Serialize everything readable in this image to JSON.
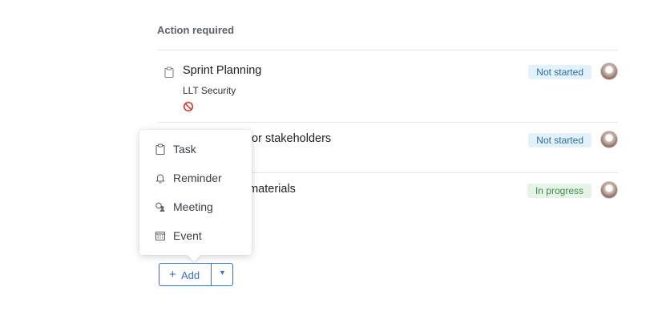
{
  "section": {
    "title": "Action required"
  },
  "items": [
    {
      "icon": "clipboard-icon",
      "title": "Sprint Planning",
      "subtitle": "LLT Security",
      "blocked_icon": "blocked-icon",
      "status": "Not started"
    },
    {
      "title_visible": "for stakeholders",
      "status": "Not started"
    },
    {
      "title_visible": "n materials",
      "status": "In progress"
    }
  ],
  "menu": {
    "items": [
      {
        "label": "Task",
        "icon": "clipboard-icon"
      },
      {
        "label": "Reminder",
        "icon": "bell-icon"
      },
      {
        "label": "Meeting",
        "icon": "meeting-icon"
      },
      {
        "label": "Event",
        "icon": "calendar-icon"
      }
    ]
  },
  "add_button": {
    "plus": "+",
    "label": "Add",
    "caret": "▼"
  },
  "colors": {
    "accent": "#3b6fd1",
    "not_started_bg": "#e3f1fb",
    "in_progress_bg": "#e5f4e7",
    "blocked": "#d93025"
  }
}
